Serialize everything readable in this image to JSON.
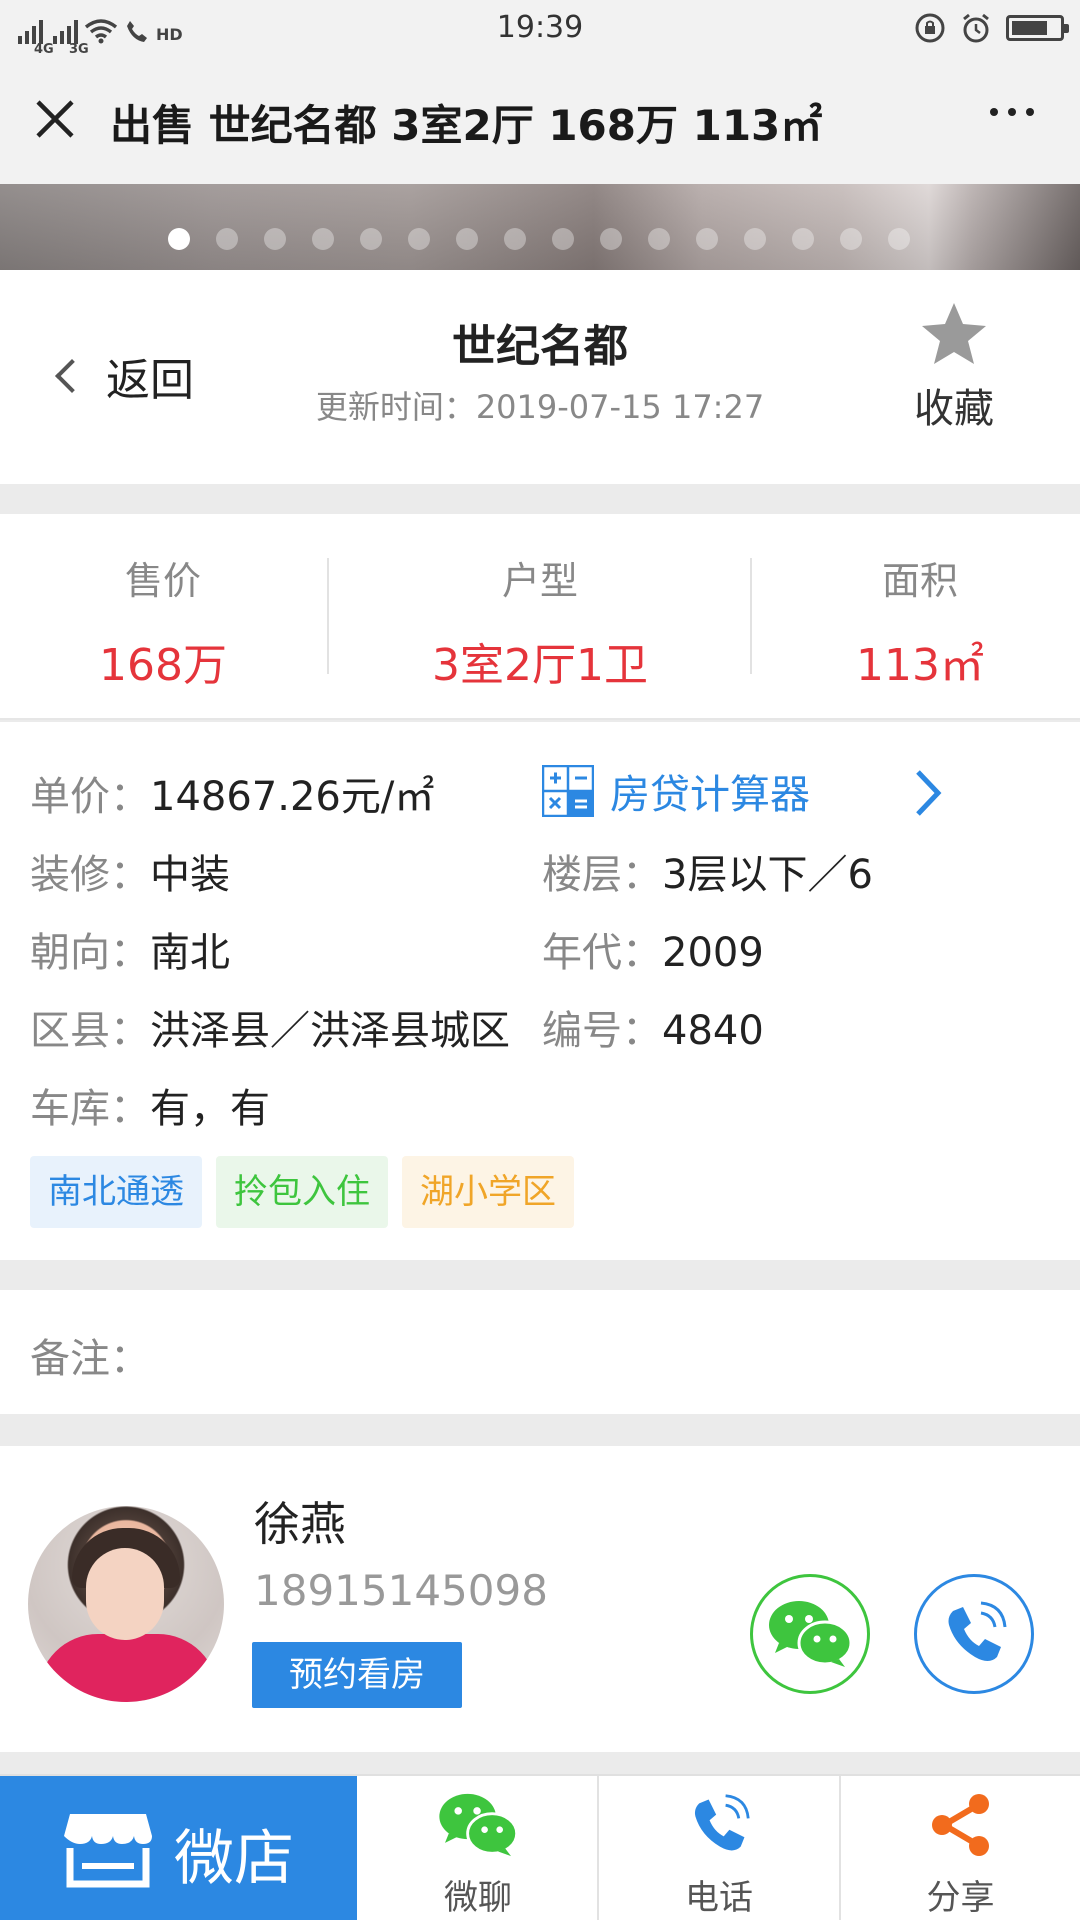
{
  "status_bar": {
    "time": "19:39",
    "signal_1": "4G",
    "signal_2": "3G",
    "call_tag": "HD",
    "battery_level": 0.75
  },
  "title_bar": {
    "title": "出售 世纪名都 3室2厅 168万 113㎡"
  },
  "banner": {
    "slide_count": 16,
    "active_index": 0
  },
  "header": {
    "back_label": "返回",
    "name": "世纪名都",
    "updated": "更新时间：2019-07-15 17:27",
    "favorite_label": "收藏"
  },
  "stats": [
    {
      "label": "售价",
      "value": "168万"
    },
    {
      "label": "户型",
      "value": "3室2厅1卫"
    },
    {
      "label": "面积",
      "value": "113㎡"
    }
  ],
  "details": {
    "unit_price_label": "单价：",
    "unit_price": "14867.26元/㎡",
    "calculator_label": "房贷计算器",
    "decoration_label": "装修：",
    "decoration": "中装",
    "floor_label": "楼层：",
    "floor": "3层以下／6",
    "orientation_label": "朝向：",
    "orientation": "南北",
    "year_label": "年代：",
    "year": "2009",
    "district_label": "区县：",
    "district": "洪泽县／洪泽县城区",
    "number_label": "编号：",
    "number": "4840",
    "garage_label": "车库：",
    "garage": "有，有"
  },
  "tags": [
    {
      "text": "南北通透",
      "color": "#2c88e2",
      "bg": "#e8f2fc"
    },
    {
      "text": "拎包入住",
      "color": "#3ec53e",
      "bg": "#eaf7ea"
    },
    {
      "text": "湖小学区",
      "color": "#f0a528",
      "bg": "#fdf4e5"
    }
  ],
  "note": {
    "label": "备注："
  },
  "agent": {
    "name": "徐燕",
    "phone": "18915145098",
    "book_label": "预约看房"
  },
  "bottom_nav": {
    "shop_label": "微店",
    "chat_label": "微聊",
    "call_label": "电话",
    "share_label": "分享"
  },
  "colors": {
    "accent": "#2c88e2",
    "price_red": "#e5343b",
    "wechat_green": "#3ec53e",
    "share_orange": "#f26b1d"
  }
}
